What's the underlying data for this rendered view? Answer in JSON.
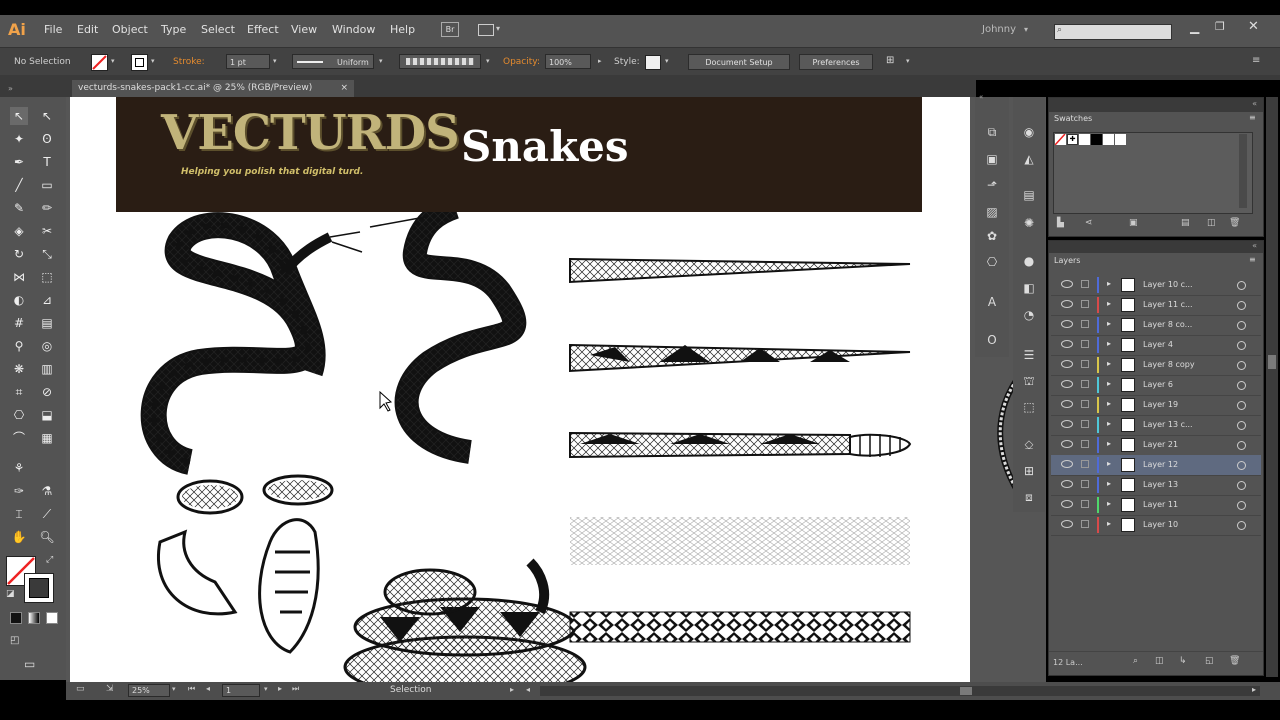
{
  "app": {
    "logo": "Ai"
  },
  "menu": [
    "File",
    "Edit",
    "Object",
    "Type",
    "Select",
    "Effect",
    "View",
    "Window",
    "Help"
  ],
  "bridge_label": "Br",
  "user": "Johnny",
  "control": {
    "selection": "No Selection",
    "stroke_label": "Stroke:",
    "stroke_weight": "1 pt",
    "profile": "Uniform",
    "opacity_label": "Opacity:",
    "opacity_value": "100%",
    "style_label": "Style:",
    "doc_setup": "Document Setup",
    "preferences": "Preferences"
  },
  "document": {
    "tab": "vecturds-snakes-pack1-cc.ai* @ 25% (RGB/Preview)",
    "close": "×"
  },
  "artwork": {
    "brand": "VECTURDS",
    "tm": "™",
    "tagline": "Helping you polish that digital turd.",
    "title": "Snakes"
  },
  "swatches": {
    "title": "Swatches"
  },
  "layers": {
    "title": "Layers",
    "count": "12 La...",
    "rows": [
      {
        "name": "Layer 10 c...",
        "color": "#4f6bd8"
      },
      {
        "name": "Layer 11 c...",
        "color": "#d84a4a"
      },
      {
        "name": "Layer 8 co...",
        "color": "#4f6bd8"
      },
      {
        "name": "Layer 4",
        "color": "#4f6bd8"
      },
      {
        "name": "Layer 8 copy",
        "color": "#d8c64a"
      },
      {
        "name": "Layer 6",
        "color": "#4fc8d8"
      },
      {
        "name": "Layer 19",
        "color": "#d8c64a"
      },
      {
        "name": "Layer 13 c...",
        "color": "#4fc8d8"
      },
      {
        "name": "Layer 21",
        "color": "#4f6bd8"
      },
      {
        "name": "Layer 12",
        "color": "#4f6bd8",
        "selected": true
      },
      {
        "name": "Layer 13",
        "color": "#4f6bd8"
      },
      {
        "name": "Layer 11",
        "color": "#4fd86b"
      },
      {
        "name": "Layer 10",
        "color": "#d84a4a"
      }
    ]
  },
  "status": {
    "zoom": "25%",
    "page": "1",
    "mode": "Selection"
  }
}
